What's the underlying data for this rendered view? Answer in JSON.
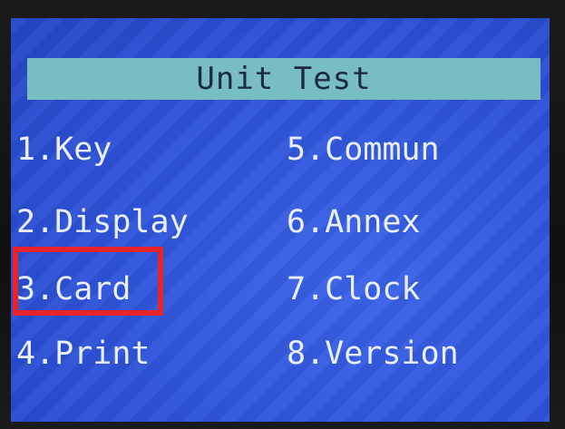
{
  "title": "Unit Test",
  "menu": {
    "items": [
      {
        "label": "1.Key"
      },
      {
        "label": "2.Display"
      },
      {
        "label": "3.Card"
      },
      {
        "label": "4.Print"
      },
      {
        "label": "5.Commun"
      },
      {
        "label": "6.Annex"
      },
      {
        "label": "7.Clock"
      },
      {
        "label": "8.Version"
      }
    ]
  },
  "highlight": {
    "target": "3.Card",
    "color": "#e8232a"
  },
  "colors": {
    "screen_background": "#2f55dc",
    "title_bar": "#77bdc2",
    "menu_text": "#e9eef9"
  }
}
